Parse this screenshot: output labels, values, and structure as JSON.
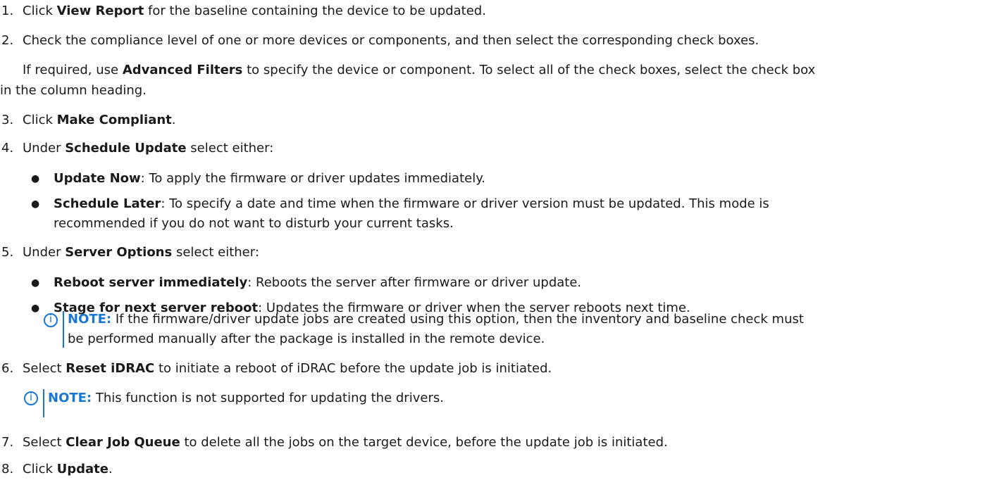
{
  "steps": [
    {
      "num": "1.",
      "pre": "Click ",
      "bold": "View Report",
      "post": " for the baseline containing the device to be updated."
    },
    {
      "num": "2.",
      "pre": "",
      "bold": "",
      "post": "Check the compliance level of one or more devices or components, and then select the corresponding check boxes."
    },
    {
      "num": "3.",
      "pre": "Click ",
      "bold": "Make Compliant",
      "post": "."
    },
    {
      "num": "4.",
      "pre": "Under ",
      "bold": "Schedule Update",
      "post": " select either:"
    },
    {
      "num": "5.",
      "pre": "Under ",
      "bold": "Server Options",
      "post": " select either:"
    },
    {
      "num": "6.",
      "pre": "Select ",
      "bold": "Reset iDRAC",
      "post": " to initiate a reboot of iDRAC before the update job is initiated."
    },
    {
      "num": "7.",
      "pre": "Select ",
      "bold": "Clear Job Queue",
      "post": " to delete all the jobs on the target device, before the update job is initiated."
    },
    {
      "num": "8.",
      "pre": "Click ",
      "bold": "Update",
      "post": "."
    }
  ],
  "step2_extra": {
    "pre": "If required, use ",
    "bold": "Advanced Filters",
    "post": " to specify the device or component. To select all of the check boxes, select the check box",
    "line2": "in the column heading."
  },
  "schedule_options": [
    {
      "bold": "Update Now",
      "text": ": To apply the firmware or driver updates immediately."
    },
    {
      "bold": "Schedule Later",
      "text": ": To specify a date and time when the firmware or driver version must be updated. This mode is",
      "line2": "recommended if you do not want to disturb your current tasks."
    }
  ],
  "server_options": [
    {
      "bold": "Reboot server immediately",
      "text": ": Reboots the server after firmware or driver update."
    },
    {
      "bold": "Stage for next server reboot",
      "text": ": Updates the firmware or driver when the server reboots next time."
    }
  ],
  "note1": {
    "label": "NOTE:",
    "line1": " If the firmware/driver update jobs are created using this option, then the inventory and baseline check must",
    "line2": "be performed manually after the package is installed in the remote device."
  },
  "note2": {
    "label": "NOTE:",
    "text": " This function is not supported for updating the drivers."
  },
  "bullet": "●",
  "colors": {
    "accent": "#1976d2",
    "text": "#1a1a1a"
  }
}
